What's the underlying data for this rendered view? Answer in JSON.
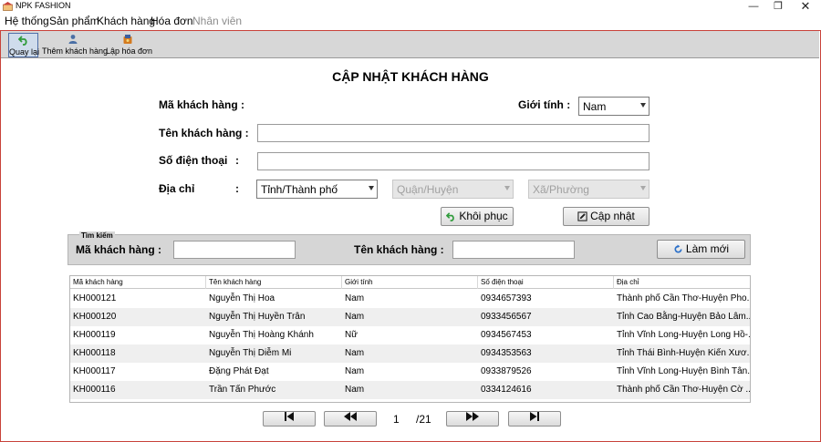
{
  "window": {
    "title": "NPK FASHION",
    "minimize": "—",
    "restore": "❐",
    "close": "✕"
  },
  "menu": [
    "Hệ thống",
    "Sản phẩm",
    "Khách hàng",
    "Hóa đơn",
    "Nhân viên"
  ],
  "toolbar": {
    "back": "Quay lại",
    "add_customer": "Thêm khách hàng",
    "create_invoice": "Lập hóa đơn"
  },
  "form": {
    "title": "CẬP NHẬT KHÁCH HÀNG",
    "customer_id_label": "Mã khách hàng  :",
    "gender_label": "Giới tính  :",
    "gender_value": "Nam",
    "name_label": "Tên khách hàng :",
    "name_value": "",
    "phone_label": "Số điện thoại",
    "phone_colon": ":",
    "phone_value": "",
    "address_label": "Địa chỉ",
    "address_colon": ":",
    "province_value": "Tỉnh/Thành phố",
    "district_value": "Quận/Huyện",
    "ward_value": "Xã/Phường",
    "restore_button": "Khôi phục",
    "update_button": "Cập nhật"
  },
  "search": {
    "legend": "Tìm kiếm",
    "id_label": "Mã khách hàng   :",
    "id_value": "",
    "name_label": "Tên khách hàng  :",
    "name_value": "",
    "refresh_button": "Làm mới"
  },
  "table": {
    "columns": [
      "Mã khách hàng",
      "Tên khách hàng",
      "Giới tính",
      "Số điện thoại",
      "Địa chỉ"
    ],
    "rows": [
      [
        "KH000121",
        "Nguyễn Thị Hoa",
        "Nam",
        "0934657393",
        "Thành phố Cần Thơ-Huyện Pho..."
      ],
      [
        "KH000120",
        "Nguyễn Thị Huyền Trân",
        "Nam",
        "0933456567",
        "Tỉnh Cao Bằng-Huyện Bảo Lâm..."
      ],
      [
        "KH000119",
        "Nguyễn Thị Hoàng Khánh",
        "Nữ",
        "0934567453",
        "Tỉnh Vĩnh Long-Huyện Long Hồ-..."
      ],
      [
        "KH000118",
        "Nguyễn Thị Diễm Mi",
        "Nam",
        "0934353563",
        "Tỉnh Thái Bình-Huyện Kiến Xươ..."
      ],
      [
        "KH000117",
        "Đặng Phát Đạt",
        "Nam",
        "0933879526",
        "Tỉnh Vĩnh Long-Huyện Bình Tân..."
      ],
      [
        "KH000116",
        "Trần Tấn Phước",
        "Nam",
        "0334124616",
        "Thành phố Cần Thơ-Huyện Cờ ..."
      ]
    ]
  },
  "pagination": {
    "first": "⏮",
    "prev": "⏪",
    "current": "1",
    "total": "/21",
    "next": "⏩",
    "last": "⏭"
  },
  "colors": {
    "frame_border": "#c8423a",
    "toolbar_bg": "#d7d7d7",
    "alt_row": "#efefef"
  }
}
